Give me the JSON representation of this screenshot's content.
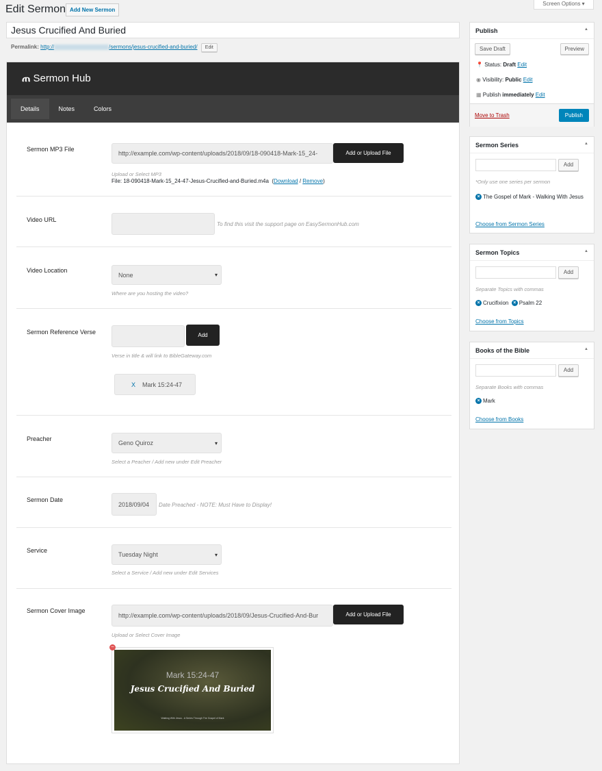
{
  "header": {
    "title": "Edit Sermon",
    "add_new": "Add New Sermon",
    "screen_options": "Screen Options ▾"
  },
  "post": {
    "title": "Jesus Crucified And Buried",
    "permalink_label": "Permalink:",
    "permalink_prefix": "http://",
    "permalink_path": "/sermons/jesus-crucified-and-buried/",
    "edit": "Edit"
  },
  "hub": {
    "brand": "Sermon Hub",
    "tabs": [
      "Details",
      "Notes",
      "Colors"
    ],
    "mp3": {
      "label": "Sermon MP3 File",
      "value": "http://example.com/wp-content/uploads/2018/09/18-090418-Mark-15_24-",
      "button": "Add or Upload File",
      "hint": "Upload or Select MP3",
      "file_label": "File:",
      "file": "18-090418-Mark-15_24-47-Jesus-Crucified-and-Buried.m4a",
      "download": "Download",
      "remove": "Remove"
    },
    "video_url": {
      "label": "Video URL",
      "value": "",
      "hint": "To find this visit the support page on EasySermonHub.com"
    },
    "video_location": {
      "label": "Video Location",
      "value": "None",
      "hint": "Where are you hosting the video?"
    },
    "verse": {
      "label": "Sermon Reference Verse",
      "button": "Add",
      "hint": "Verse in title & will link to BibleGateway.com",
      "tag_x": "X",
      "tag": "Mark 15:24-47"
    },
    "preacher": {
      "label": "Preacher",
      "value": "Geno Quiroz",
      "hint": "Select a Peacher / Add new under Edit Preacher"
    },
    "date": {
      "label": "Sermon Date",
      "value": "2018/09/04",
      "hint": "Date Preached - NOTE: Must Have to Display!"
    },
    "service": {
      "label": "Service",
      "value": "Tuesday Night",
      "hint": "Select a Service / Add new under Edit Services"
    },
    "cover": {
      "label": "Sermon Cover Image",
      "value": "http://example.com/wp-content/uploads/2018/09/Jesus-Crucified-And-Bur",
      "button": "Add or Upload File",
      "hint": "Upload or Select Cover Image",
      "img_ref": "Mark 15:24-47",
      "img_title": "Jesus Crucified And Buried",
      "img_sub": "Walking With Jesus - A Series Through The Gospel of Mark"
    }
  },
  "publish": {
    "title": "Publish",
    "save_draft": "Save Draft",
    "preview": "Preview",
    "status_label": "Status:",
    "status": "Draft",
    "visibility_label": "Visibility:",
    "visibility": "Public",
    "publish_label": "Publish",
    "publish_when": "immediately",
    "edit": "Edit",
    "trash": "Move to Trash",
    "publish": "Publish"
  },
  "series": {
    "title": "Sermon Series",
    "add": "Add",
    "note": "*Only use one series per sermon",
    "items": [
      "The Gospel of Mark - Walking With Jesus"
    ],
    "choose": "Choose from Sermon Series"
  },
  "topics": {
    "title": "Sermon Topics",
    "add": "Add",
    "note": "Separate Topics with commas",
    "items": [
      "Crucifixion",
      "Psalm 22"
    ],
    "choose": "Choose from Topics"
  },
  "books": {
    "title": "Books of the Bible",
    "add": "Add",
    "note": "Separate Books with commas",
    "items": [
      "Mark"
    ],
    "choose": "Choose from Books"
  }
}
